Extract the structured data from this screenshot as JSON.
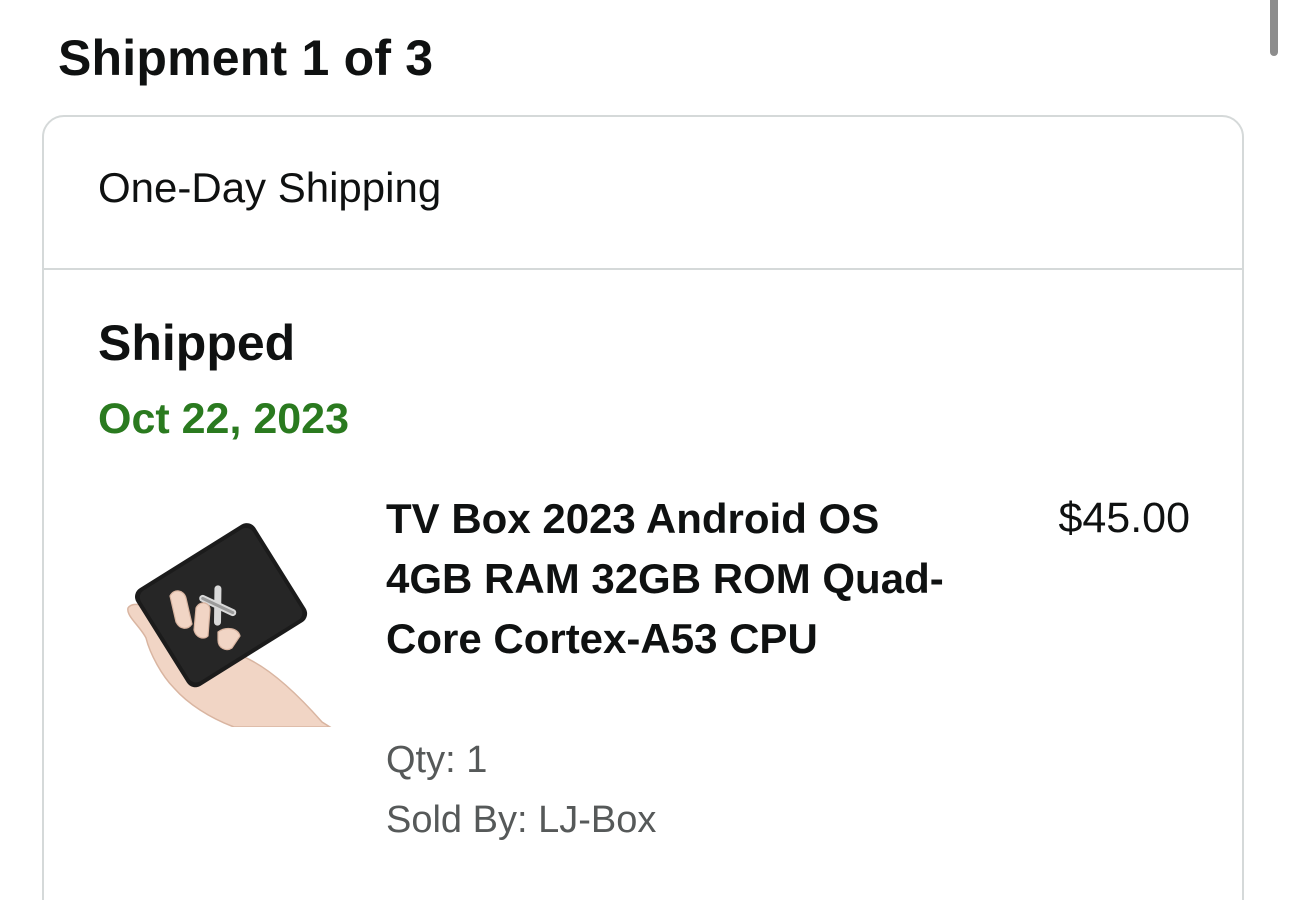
{
  "shipment": {
    "title": "Shipment 1 of 3",
    "shipping_speed": "One-Day Shipping",
    "status": "Shipped",
    "status_date": "Oct 22, 2023"
  },
  "item": {
    "title": "TV Box 2023 Android OS 4GB RAM 32GB ROM Quad-Core Cortex-A53 CPU",
    "price": "$45.00",
    "qty": "Qty: 1",
    "sold_by": "Sold By: LJ-Box",
    "image_icon": "tv-box-in-hand-image"
  },
  "colors": {
    "status_green": "#2a7a1f",
    "secondary_text": "#565959",
    "border": "#d5d9d9"
  }
}
